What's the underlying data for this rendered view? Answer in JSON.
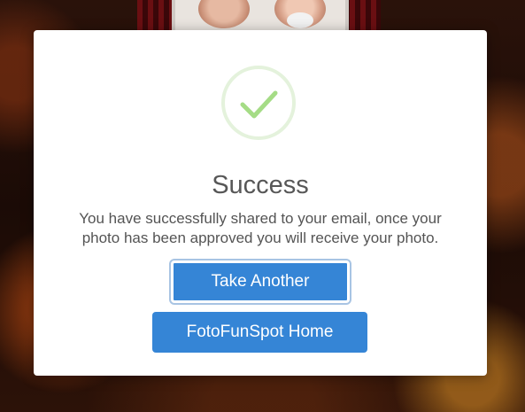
{
  "background": {
    "photo": "couple-photo"
  },
  "dialog": {
    "icon": "checkmark-icon",
    "icon_color": "#a5dc86",
    "title": "Success",
    "message_line1": "You have successfully shared to your email, once your",
    "message_line2": "photo has been approved you will receive your photo.",
    "buttons": {
      "take_another": "Take Another",
      "home": "FotoFunSpot Home"
    },
    "button_color": "#3585d6"
  }
}
